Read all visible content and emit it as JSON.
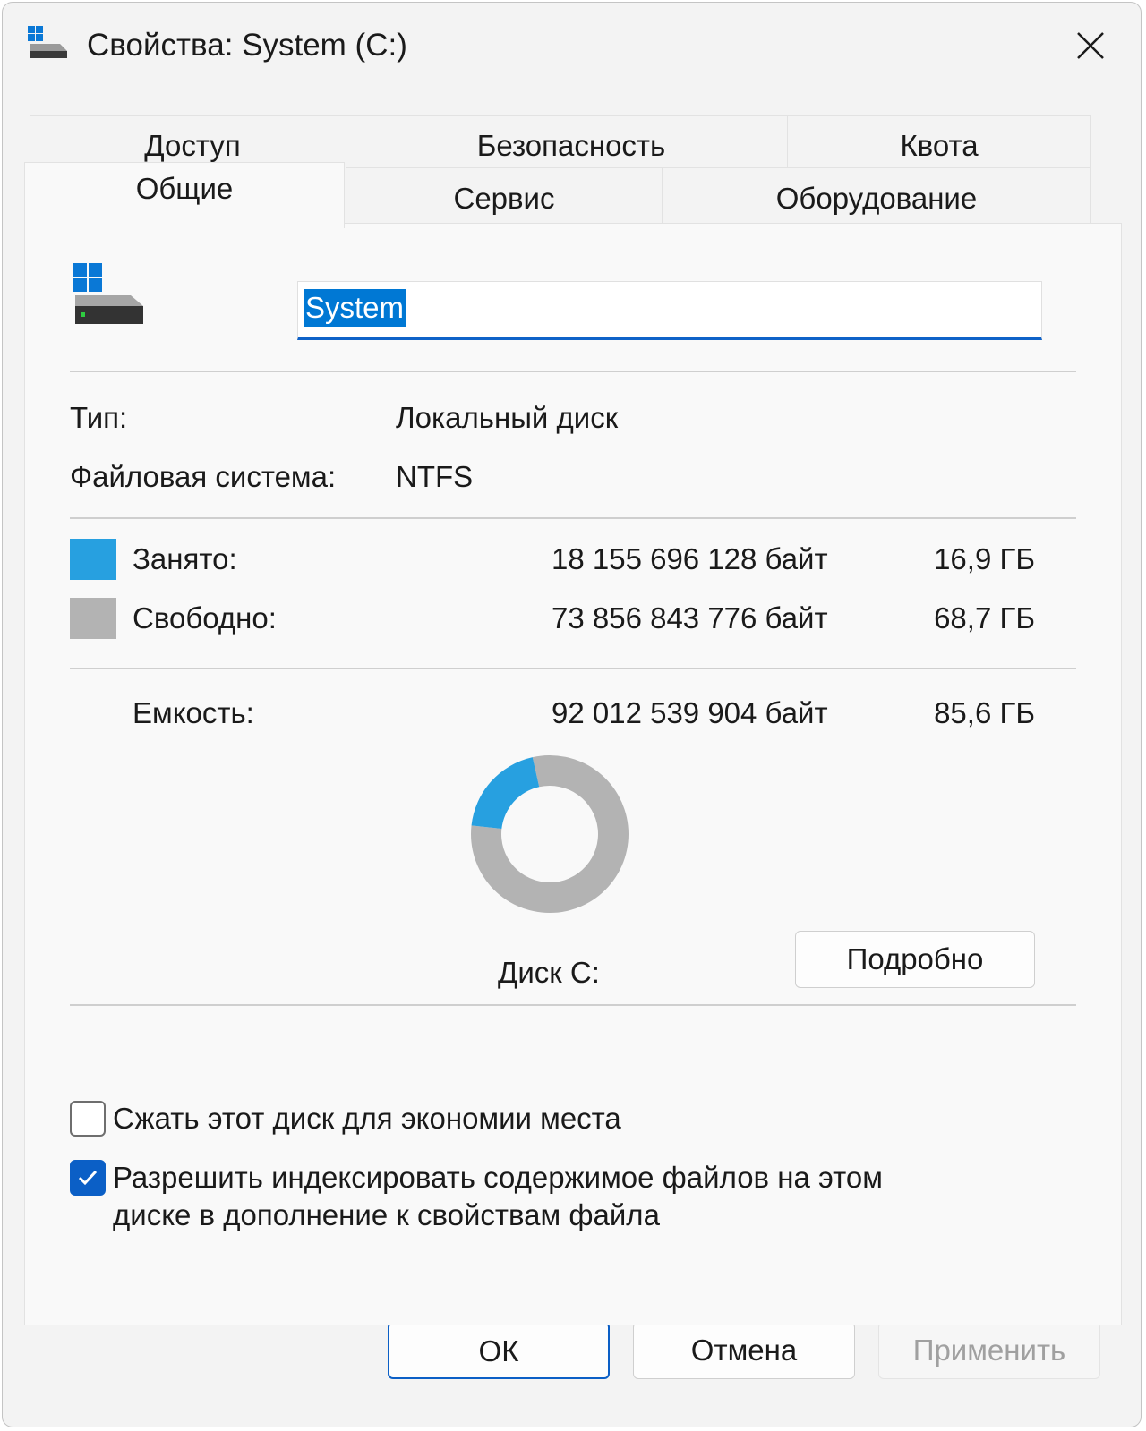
{
  "window": {
    "title": "Свойства: System (C:)"
  },
  "tabs": {
    "row1": [
      "Доступ",
      "Безопасность",
      "Квота"
    ],
    "row2": [
      "Сервис",
      "Оборудование"
    ],
    "active": "Общие"
  },
  "general": {
    "volume_name": "System",
    "type_label": "Тип:",
    "type_value": "Локальный диск",
    "fs_label": "Файловая система:",
    "fs_value": "NTFS",
    "used_label": "Занято:",
    "used_bytes": "18 155 696 128 байт",
    "used_gb": "16,9 ГБ",
    "free_label": "Свободно:",
    "free_bytes": "73 856 843 776 байт",
    "free_gb": "68,7 ГБ",
    "capacity_label": "Емкость:",
    "capacity_bytes": "92 012 539 904 байт",
    "capacity_gb": "85,6 ГБ",
    "disk_label": "Диск C:",
    "details_button": "Подробно",
    "compress_label": "Сжать этот диск для экономии места",
    "compress_checked": false,
    "index_label_line1": "Разрешить индексировать содержимое файлов на этом",
    "index_label_line2": "диске в дополнение к свойствам файла",
    "index_checked": true
  },
  "colors": {
    "used": "#27a0e0",
    "free": "#b3b3b3",
    "accent": "#0b5fc6"
  },
  "chart_data": {
    "type": "pie",
    "categories": [
      "Занято",
      "Свободно"
    ],
    "values": [
      16.9,
      68.7
    ]
  },
  "footer": {
    "ok": "ОК",
    "cancel": "Отмена",
    "apply": "Применить"
  }
}
